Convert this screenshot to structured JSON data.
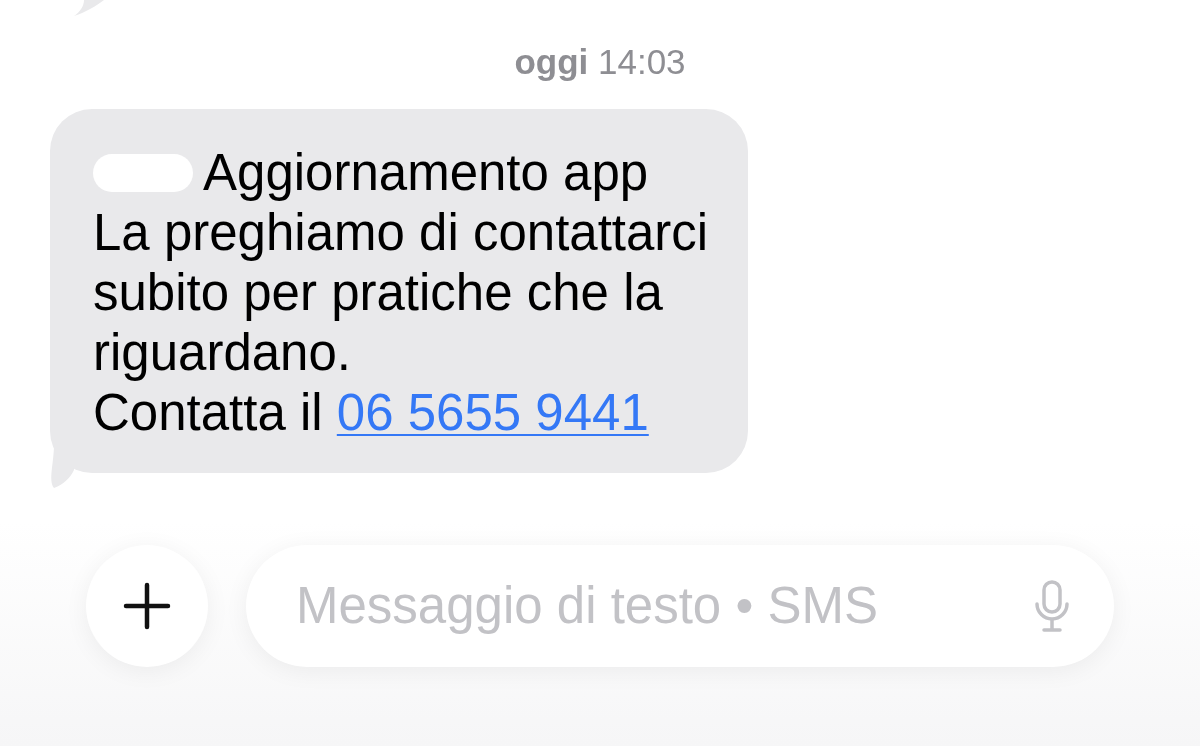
{
  "timestamp": {
    "day": "oggi",
    "time": "14:03"
  },
  "message": {
    "title": "Aggiornamento app",
    "body_lines": [
      "La preghiamo di contattarci",
      "subito per pratiche che la",
      "riguardano."
    ],
    "contact_text": "Contatta il",
    "phone_link": "06 5655 9441"
  },
  "composer": {
    "placeholder": "Messaggio di testo • SMS"
  }
}
